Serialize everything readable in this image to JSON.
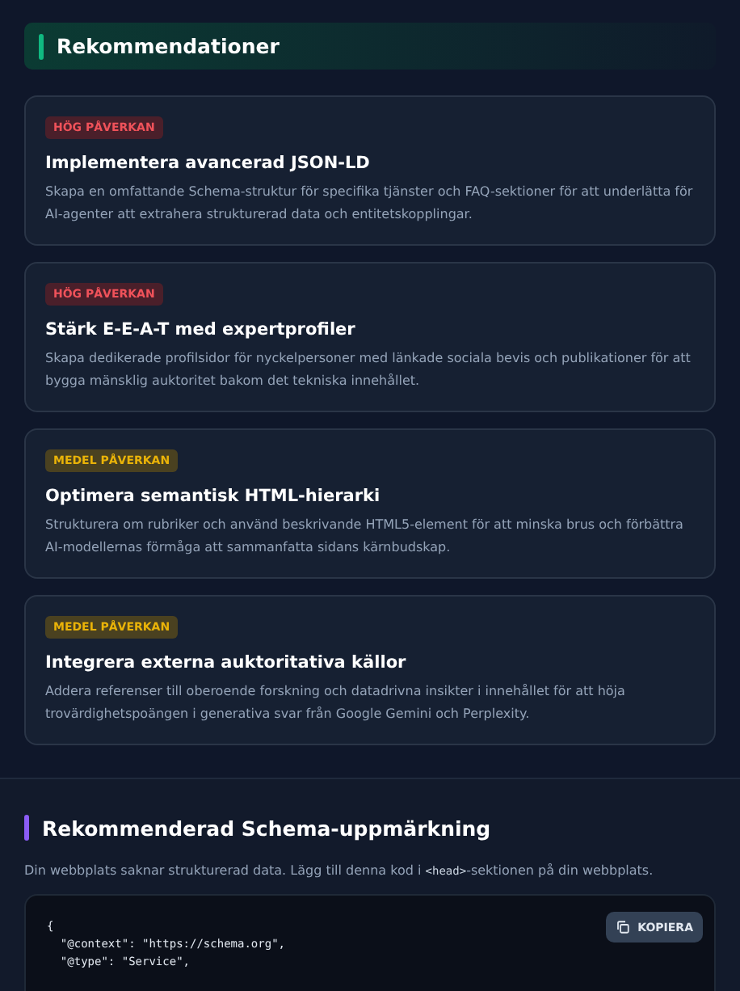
{
  "recommendations": {
    "title": "Rekommendationer",
    "items": [
      {
        "kind": "high",
        "badge": "HÖG PÅVERKAN",
        "title": "Implementera avancerad JSON-LD",
        "text": "Skapa en omfattande Schema-struktur för specifika tjänster och FAQ-sektioner för att underlätta för AI-agenter att extrahera strukturerad data och entitetskopplingar."
      },
      {
        "kind": "high",
        "badge": "HÖG PÅVERKAN",
        "title": "Stärk E-E-A-T med expertprofiler",
        "text": "Skapa dedikerade profilsidor för nyckelpersoner med länkade sociala bevis och publikationer för att bygga mänsklig auktoritet bakom det tekniska innehållet."
      },
      {
        "kind": "medium",
        "badge": "MEDEL PÅVERKAN",
        "title": "Optimera semantisk HTML-hierarki",
        "text": "Strukturera om rubriker och använd beskrivande HTML5-element för att minska brus och förbättra AI-modellernas förmåga att sammanfatta sidans kärnbudskap."
      },
      {
        "kind": "medium",
        "badge": "MEDEL PÅVERKAN",
        "title": "Integrera externa auktoritativa källor",
        "text": "Addera referenser till oberoende forskning och datadrivna insikter i innehållet för att höja trovärdighetspoängen i generativa svar från Google Gemini och Perplexity."
      }
    ]
  },
  "schema": {
    "title": "Rekommenderad Schema-uppmärkning",
    "intro": {
      "before": "Din webbplats saknar strukturerad data. Lägg till denna kod i ",
      "code": "<head>",
      "after": "-sektionen på din webbplats."
    },
    "copy_button": "KOPIERA",
    "code_lines": [
      "{",
      "  \"@context\": \"https://schema.org\",",
      "  \"@type\": \"Service\","
    ]
  }
}
